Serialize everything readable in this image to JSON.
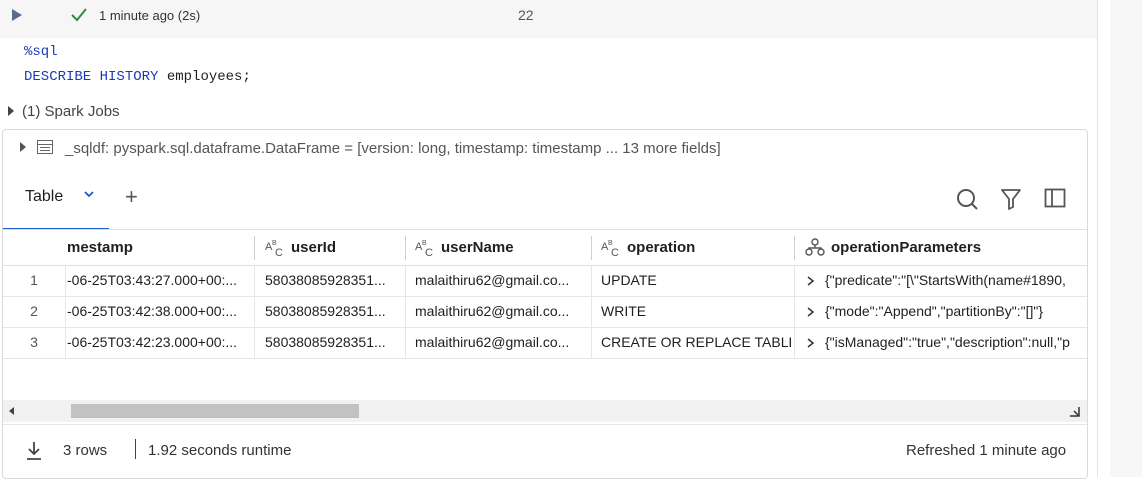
{
  "cell": {
    "exec_time": "1 minute ago (2s)",
    "command_number": "22",
    "code": {
      "magic": "%sql",
      "keyword1": "DESCRIBE",
      "keyword2": "HISTORY",
      "table": "employees;"
    },
    "spark_jobs": "(1) Spark Jobs"
  },
  "result": {
    "dataframe_line": "_sqldf:  pyspark.sql.dataframe.DataFrame = [version: long, timestamp: timestamp ... 13 more fields]",
    "tab_label": "Table",
    "add_label": "+",
    "columns": [
      {
        "name": "mestamp",
        "type_icon": "none"
      },
      {
        "name": "userId",
        "type_icon": "string-type-icon"
      },
      {
        "name": "userName",
        "type_icon": "string-type-icon"
      },
      {
        "name": "operation",
        "type_icon": "string-type-icon"
      },
      {
        "name": "operationParameters",
        "type_icon": "struct-type-icon"
      }
    ],
    "rows": [
      {
        "num": "1",
        "timestamp": "-06-25T03:43:27.000+00:...",
        "userId": "58038085928351...",
        "userName": "malaithiru62@gmail.co...",
        "operation": "UPDATE",
        "params": "{\"predicate\":\"[\\\"StartsWith(name#1890,"
      },
      {
        "num": "2",
        "timestamp": "-06-25T03:42:38.000+00:...",
        "userId": "58038085928351...",
        "userName": "malaithiru62@gmail.co...",
        "operation": "WRITE",
        "params": "{\"mode\":\"Append\",\"partitionBy\":\"[]\"}"
      },
      {
        "num": "3",
        "timestamp": "-06-25T03:42:23.000+00:...",
        "userId": "58038085928351...",
        "userName": "malaithiru62@gmail.co...",
        "operation": "CREATE OR REPLACE TABLE",
        "params": "{\"isManaged\":\"true\",\"description\":null,\"p"
      }
    ],
    "footer": {
      "rows": "3 rows",
      "runtime": "1.92 seconds runtime",
      "refreshed": "Refreshed 1 minute ago"
    }
  },
  "colors": {
    "accent": "#1b5cc8",
    "success": "#2e8b3a",
    "keyword": "#1a3bb8"
  }
}
